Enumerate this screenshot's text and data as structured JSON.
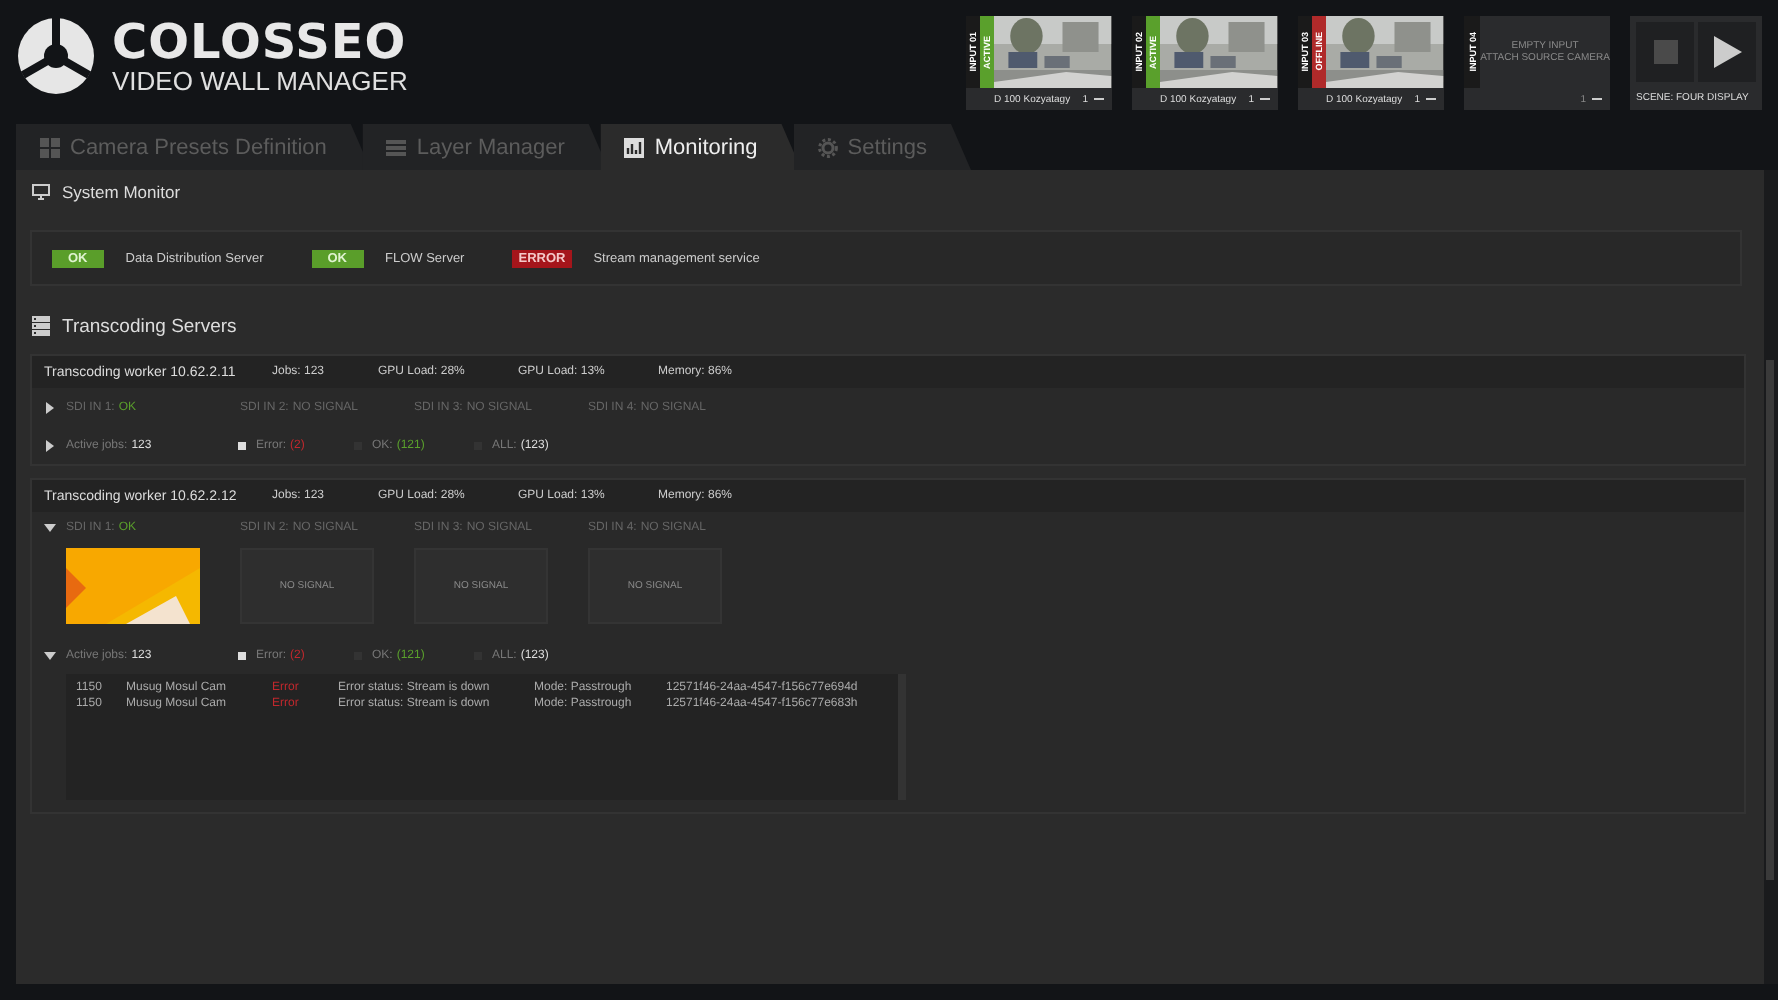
{
  "app": {
    "title": "COLOSSEO",
    "subtitle": "VIDEO WALL MANAGER"
  },
  "inputs": [
    {
      "kind": "camera",
      "label": "INPUT 01",
      "status": "ACTIVE",
      "color": "#5aa02c",
      "caption": "D 100 Kozyatagy",
      "count": "1"
    },
    {
      "kind": "camera",
      "label": "INPUT 02",
      "status": "ACTIVE",
      "color": "#5aa02c",
      "caption": "D 100 Kozyatagy",
      "count": "1"
    },
    {
      "kind": "camera",
      "label": "INPUT 03",
      "status": "OFFLINE",
      "color": "#b02a2a",
      "caption": "D 100 Kozyatagy",
      "count": "1"
    },
    {
      "kind": "empty",
      "label": "INPUT 04",
      "message": "EMPTY INPUT",
      "hint": "ATTACH SOURCE CAMERA",
      "count": "1"
    }
  ],
  "scene": {
    "label": "SCENE: FOUR DISPLAY"
  },
  "tabs": [
    {
      "label": "Camera Presets Definition",
      "selected": false
    },
    {
      "label": "Layer Manager",
      "selected": false
    },
    {
      "label": "Monitoring",
      "selected": true
    },
    {
      "label": "Settings",
      "selected": false
    }
  ],
  "system_monitor": {
    "title": "System Monitor",
    "services": [
      {
        "status": "OK",
        "kind": "ok",
        "name": "Data Distribution Server"
      },
      {
        "status": "OK",
        "kind": "ok",
        "name": "FLOW Server"
      },
      {
        "status": "ERROR",
        "kind": "error",
        "name": "Stream management service"
      }
    ]
  },
  "transcoding": {
    "title": "Transcoding Servers",
    "workers": [
      {
        "name": "Transcoding worker 10.62.2.11",
        "stats": [
          "Jobs: 123",
          "GPU Load: 28%",
          "GPU Load: 13%",
          "Memory: 86%"
        ],
        "inputs_expanded": false,
        "sdi": [
          {
            "label": "SDI IN 1:",
            "value": "OK",
            "ok": true
          },
          {
            "label": "SDI IN 2:",
            "value": "NO SIGNAL",
            "ok": false
          },
          {
            "label": "SDI IN 3:",
            "value": "NO SIGNAL",
            "ok": false
          },
          {
            "label": "SDI IN 4:",
            "value": "NO SIGNAL",
            "ok": false
          }
        ],
        "jobs_expanded": false,
        "active_label": "Active jobs:",
        "active_value": "123",
        "filters": [
          {
            "kind": "error",
            "label": "Error:",
            "value": "(2)",
            "checked": true
          },
          {
            "kind": "ok",
            "label": "OK:",
            "value": "(121)",
            "checked": false
          },
          {
            "kind": "all",
            "label": "ALL:",
            "value": "(123)",
            "checked": false
          }
        ]
      },
      {
        "name": "Transcoding worker 10.62.2.12",
        "stats": [
          "Jobs: 123",
          "GPU Load: 28%",
          "GPU Load: 13%",
          "Memory: 86%"
        ],
        "inputs_expanded": true,
        "sdi": [
          {
            "label": "SDI IN 1:",
            "value": "OK",
            "ok": true
          },
          {
            "label": "SDI IN 2:",
            "value": "NO SIGNAL",
            "ok": false,
            "preview": {
              "kind": "no_signal",
              "text": "NO SIGNAL"
            }
          },
          {
            "label": "SDI IN 3:",
            "value": "NO SIGNAL",
            "ok": false,
            "preview": {
              "kind": "no_signal",
              "text": "NO SIGNAL"
            }
          },
          {
            "label": "SDI IN 4:",
            "value": "NO SIGNAL",
            "ok": false,
            "preview": {
              "kind": "no_signal",
              "text": "NO SIGNAL"
            }
          }
        ],
        "jobs_expanded": true,
        "active_label": "Active jobs:",
        "active_value": "123",
        "filters": [
          {
            "kind": "error",
            "label": "Error:",
            "value": "(2)",
            "checked": true
          },
          {
            "kind": "ok",
            "label": "OK:",
            "value": "(121)",
            "checked": false
          },
          {
            "kind": "all",
            "label": "ALL:",
            "value": "(123)",
            "checked": false
          }
        ],
        "jobs": [
          {
            "id": "1150",
            "source": "Musug Mosul Cam",
            "state": "Error",
            "message": "Error status: Stream is down",
            "mode": "Mode: Passtrough",
            "uuid": "12571f46-24aa-4547-f156c77e694d"
          },
          {
            "id": "1150",
            "source": "Musug Mosul Cam",
            "state": "Error",
            "message": "Error status: Stream is down",
            "mode": "Mode: Passtrough",
            "uuid": "12571f46-24aa-4547-f156c77e683h"
          }
        ]
      }
    ]
  }
}
